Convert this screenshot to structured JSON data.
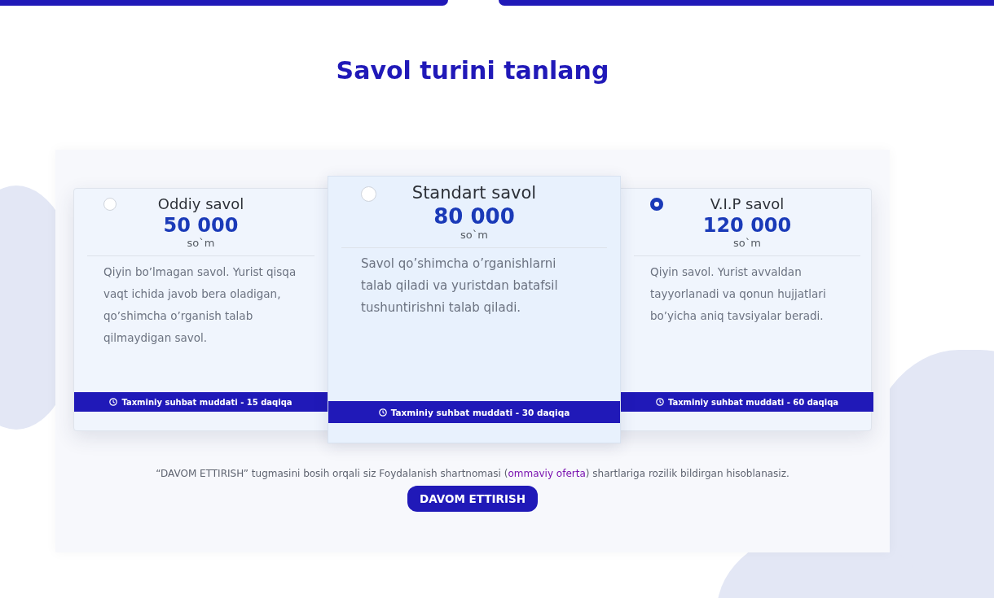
{
  "title": "Savol turini tanlang",
  "plans": [
    {
      "name": "Oddiy savol",
      "price": "50 000",
      "currency": "so`m",
      "description": "Qiyin bo’lmagan savol. Yurist qisqa vaqt ichida javob bera oladigan, qo’shimcha o’rganish talab qilmaydigan savol.",
      "duration": "Taxminiy suhbat muddati - 15 daqiqa",
      "selected": false,
      "raised": false
    },
    {
      "name": "Standart savol",
      "price": "80 000",
      "currency": "so`m",
      "description": "Savol qo’shimcha o’rganishlarni talab qiladi va yuristdan batafsil tushuntirishni talab qiladi.",
      "duration": "Taxminiy suhbat muddati - 30 daqiqa",
      "selected": false,
      "raised": true
    },
    {
      "name": "V.I.P savol",
      "price": "120 000",
      "currency": "so`m",
      "description": "Qiyin savol. Yurist avvaldan tayyorlanadi va qonun hujjatlari bo’yicha aniq tavsiyalar beradi.",
      "duration": "Taxminiy suhbat muddati - 60 daqiqa",
      "selected": true,
      "raised": false
    }
  ],
  "notice": {
    "before": "“DAVOM ETTIRISH” tugmasini bosih orqali siz Foydalanish shartnomasi (",
    "link": "ommaviy oferta",
    "after": ") shartlariga rozilik bildirgan hisoblanasiz."
  },
  "button": "DAVOM ETTIRISH"
}
